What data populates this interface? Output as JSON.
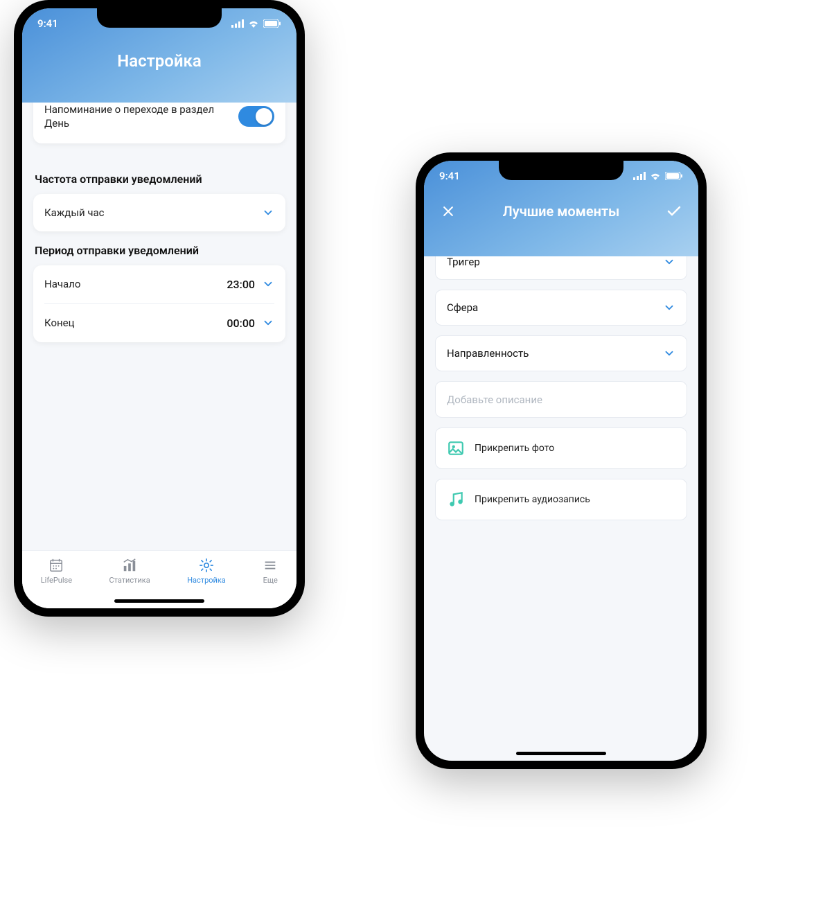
{
  "status": {
    "time": "9:41"
  },
  "phone1": {
    "title": "Настройка",
    "reminder": {
      "label": "Напоминание о переходе в раздел День",
      "on": true
    },
    "freq_heading": "Частота отправки уведомлений",
    "freq_value": "Каждый час",
    "period_heading": "Период отправки уведомлений",
    "period": {
      "start_label": "Начало",
      "start_value": "23:00",
      "end_label": "Конец",
      "end_value": "00:00"
    },
    "tabs": [
      {
        "label": "LifePulse"
      },
      {
        "label": "Статистика"
      },
      {
        "label": "Настройка"
      },
      {
        "label": "Еще"
      }
    ]
  },
  "phone2": {
    "title": "Лучшие моменты",
    "dropdowns": [
      {
        "label": "Тригер"
      },
      {
        "label": "Сфера"
      },
      {
        "label": "Направленность"
      }
    ],
    "description_placeholder": "Добавьте описание",
    "attach_photo": "Прикрепить фото",
    "attach_audio": "Прикрепить аудиозапись"
  }
}
